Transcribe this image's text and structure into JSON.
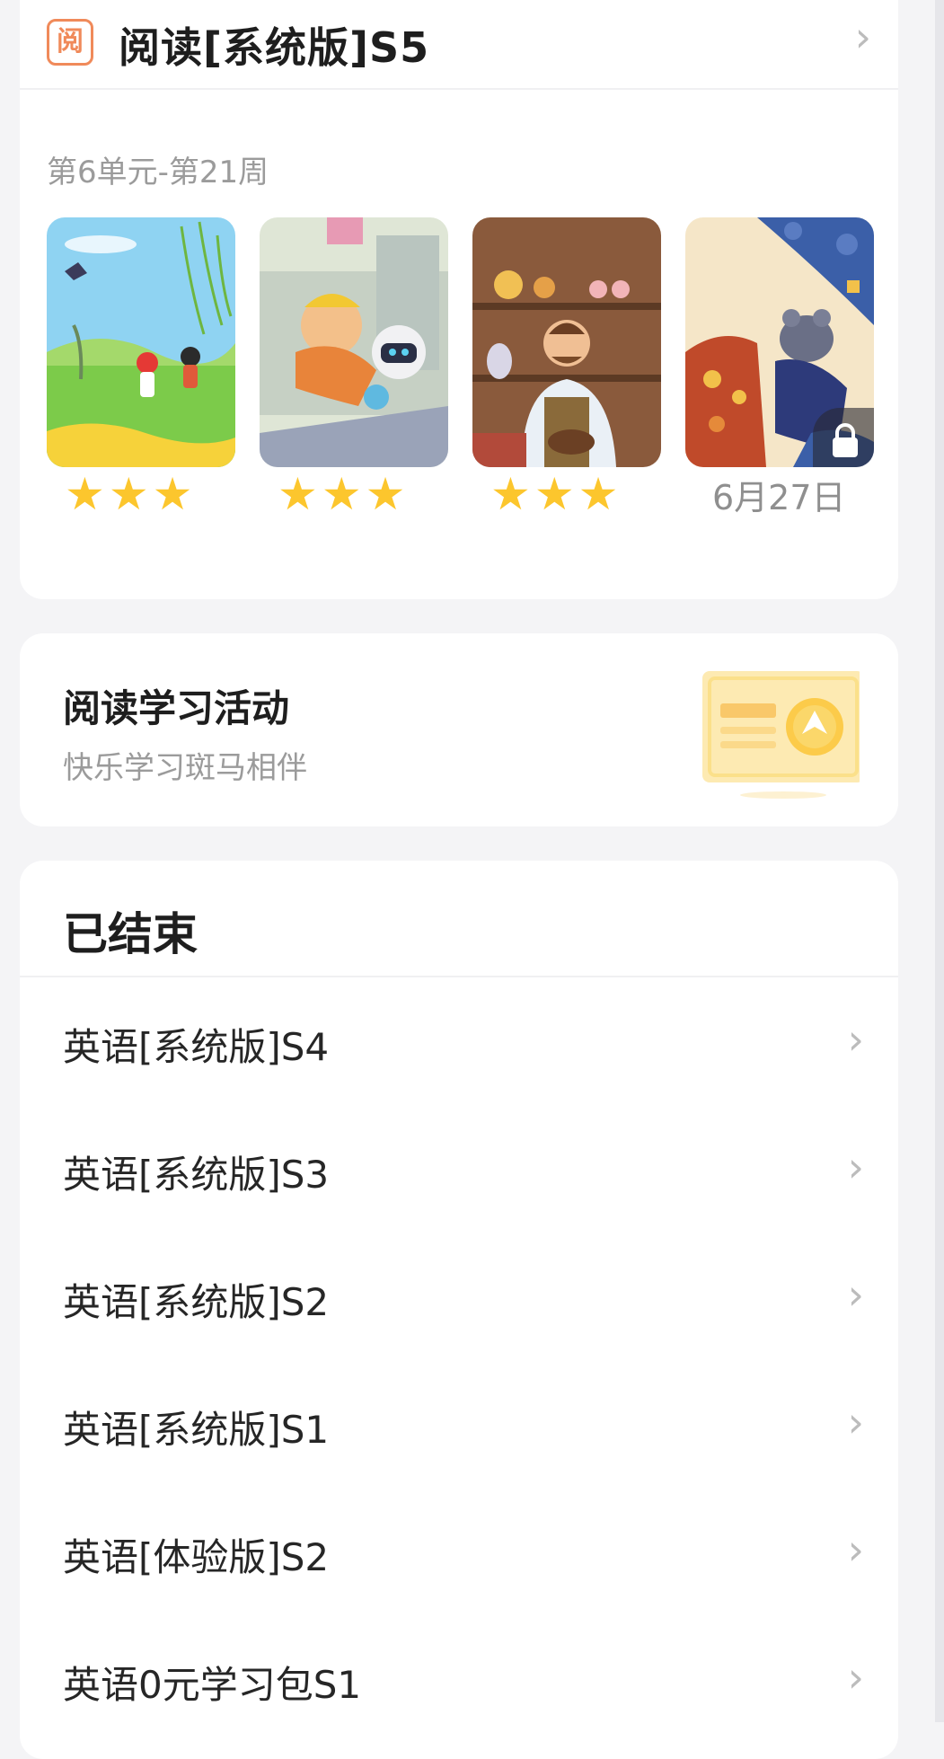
{
  "course": {
    "icon_char": "阅",
    "icon_name": "reading-badge-icon",
    "title": "阅读[系统版]S5",
    "unit_label": "第6单元-第21周",
    "lessons": [
      {
        "name": "spring-kite-scene",
        "stars": "★★★",
        "star_count": 3
      },
      {
        "name": "boy-with-robot-scene",
        "stars": "★★★",
        "star_count": 3
      },
      {
        "name": "toymaker-shop-scene",
        "stars": "★★★",
        "star_count": 3
      },
      {
        "name": "mouse-costume-scene",
        "locked": true,
        "unlock_date": "6月27日"
      }
    ],
    "star_color": "#fcc62d"
  },
  "activity": {
    "title": "阅读学习活动",
    "subtitle": "快乐学习斑马相伴"
  },
  "ended": {
    "title": "已结束",
    "items": [
      {
        "label": "英语[系统版]S4"
      },
      {
        "label": "英语[系统版]S3"
      },
      {
        "label": "英语[系统版]S2"
      },
      {
        "label": "英语[系统版]S1"
      },
      {
        "label": "英语[体验版]S2"
      },
      {
        "label": "英语0元学习包S1"
      }
    ]
  },
  "icons": {
    "chevron": "›"
  },
  "colors": {
    "accent": "#f08a5a",
    "star": "#fcc62d",
    "background": "#f4f4f6"
  }
}
